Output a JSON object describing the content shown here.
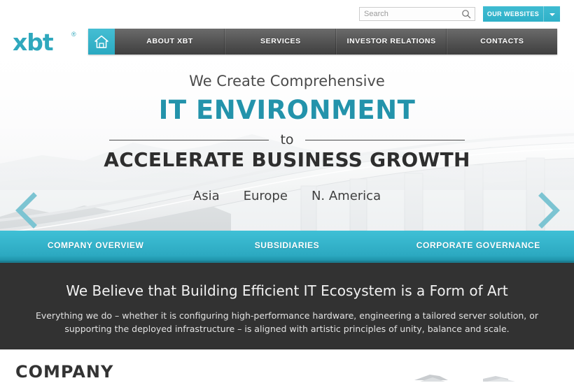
{
  "brand": {
    "logo_text": "xbt",
    "logo_registered": "®",
    "accent_color": "#2fa8bd",
    "teal_bar_color": "#2ca9c1",
    "dark_section_color": "#323232"
  },
  "topbar": {
    "search": {
      "placeholder": "Search",
      "value": "",
      "icon": "search-icon"
    },
    "our_websites": {
      "label": "OUR WEBSITES",
      "caret_icon": "chevron-down-icon"
    }
  },
  "mainnav": {
    "home_icon": "home-icon",
    "items": [
      {
        "label": "ABOUT XBT"
      },
      {
        "label": "SERVICES"
      },
      {
        "label": "INVESTOR RELATIONS"
      },
      {
        "label": "CONTACTS"
      }
    ]
  },
  "hero": {
    "line1": "We Create Comprehensive",
    "line2": "IT ENVIRONMENT",
    "connector": "to",
    "line3": "ACCELERATE BUSINESS GROWTH",
    "regions": [
      {
        "label": "Asia"
      },
      {
        "label": "Europe"
      },
      {
        "label": "N. America"
      }
    ],
    "prev_icon": "chevron-left-icon",
    "next_icon": "chevron-right-icon"
  },
  "section_nav": {
    "items": [
      {
        "label": "COMPANY OVERVIEW"
      },
      {
        "label": "SUBSIDIARIES"
      },
      {
        "label": "CORPORATE GOVERNANCE"
      }
    ]
  },
  "belief": {
    "heading": "We Believe that Building Efficient IT Ecosystem is a Form of Art",
    "body": "Everything we do – whether it is configuring high-performance hardware, engineering a tailored server solution, or supporting the deployed infrastructure – is aligned with artistic principles of unity, balance and scale."
  },
  "company": {
    "title": "COMPANY"
  }
}
